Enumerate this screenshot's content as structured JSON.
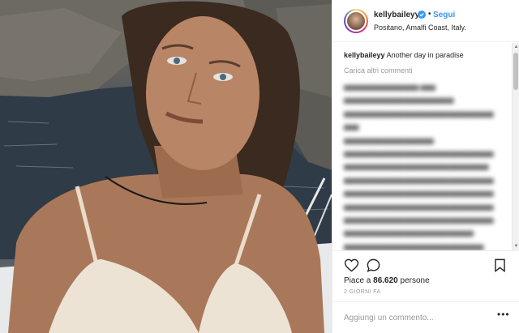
{
  "post": {
    "username": "kellybaileyy",
    "follow_label": "Segui",
    "separator": "•",
    "location": "Positano, Amalfi Coast, Italy.",
    "caption": {
      "username": "kellybaileyy",
      "text": "Another day in paradise"
    },
    "load_more": "Carica altri commenti",
    "likes": {
      "prefix": "Piace a",
      "count": "86.620",
      "suffix": "persone"
    },
    "time_ago": "2 GIORNI FA",
    "comment_placeholder": "Aggiungi un commento...",
    "more_label": "•••"
  },
  "icons": {
    "verified": "verified-badge-icon",
    "like": "heart-icon",
    "comment": "comment-bubble-icon",
    "save": "bookmark-icon",
    "scroll_up": "scroll-up-arrow",
    "scroll_down": "scroll-down-arrow"
  },
  "colors": {
    "accent": "#3897f0",
    "text": "#262626",
    "muted": "#999999",
    "border": "#efefef"
  }
}
